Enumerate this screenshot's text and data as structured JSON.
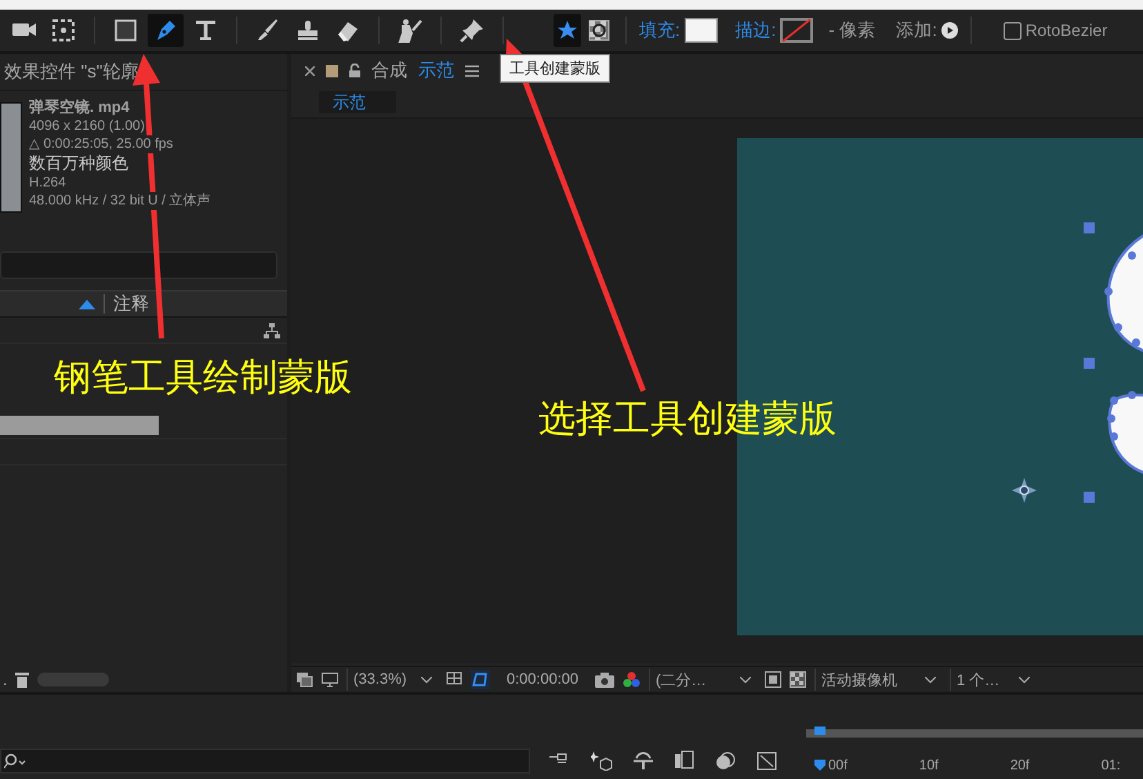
{
  "toolbar": {
    "tools": [
      {
        "kind": "camera",
        "selected": false
      },
      {
        "kind": "region",
        "selected": false
      },
      {
        "kind": "rectangle",
        "selected": false
      },
      {
        "kind": "pen",
        "selected": true
      },
      {
        "kind": "type",
        "selected": false
      },
      {
        "kind": "brush",
        "selected": false
      },
      {
        "kind": "stamp",
        "selected": false
      },
      {
        "kind": "eraser",
        "selected": false
      },
      {
        "kind": "puppet",
        "selected": false
      },
      {
        "kind": "pin",
        "selected": false
      }
    ],
    "mask_modes": [
      {
        "kind": "shape",
        "selected": true
      },
      {
        "kind": "mask",
        "selected": false
      }
    ],
    "fill_label": "填充:",
    "stroke_label": "描边:",
    "stroke_width": "- 像素",
    "add_label": "添加:",
    "rotobezier": {
      "label": "RotoBezier",
      "checked": false
    },
    "tooltip": "工具创建蒙版"
  },
  "effects_panel": {
    "title": "效果控件 \"s\"轮廓",
    "file_name": "弹琴空镜. mp4",
    "details": [
      "4096 x 2160 (1.00)",
      "△ 0:00:25:05, 25.00 fps",
      "数百万种颜色",
      "H.264",
      "48.000 kHz / 32 bit U / 立体声"
    ],
    "column": "注释",
    "layer_rows": [
      {
        "selected": true
      },
      {
        "selected": false
      }
    ],
    "footer": "."
  },
  "composition_panel": {
    "label": "合成",
    "name": "示范",
    "tab": "示范",
    "zoom": "(33.3%)",
    "timecode": "0:00:00:00",
    "resolution": "(二分…",
    "camera": "活动摄像机",
    "views": "1 个…"
  },
  "timeline": {
    "ruler": [
      "00f",
      "10f",
      "20f",
      "01:"
    ]
  },
  "annotations": [
    "钢笔工具绘制蒙版",
    "选择工具创建蒙版"
  ]
}
